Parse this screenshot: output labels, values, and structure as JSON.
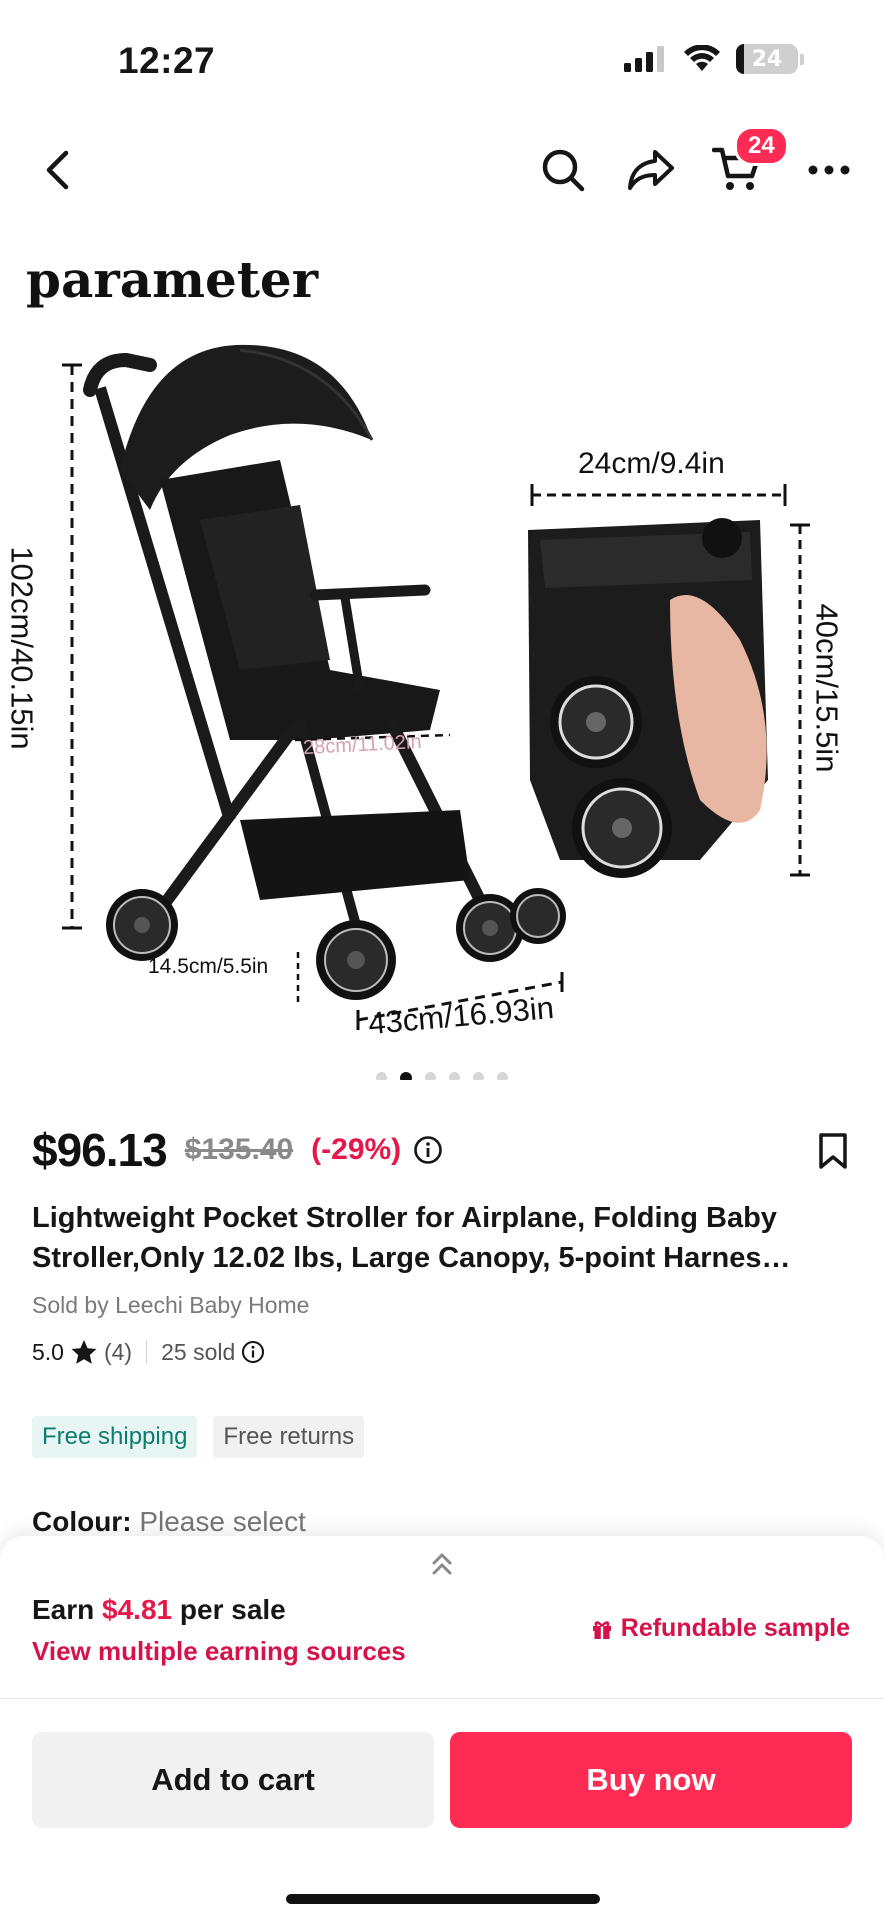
{
  "status": {
    "time": "12:27",
    "battery": "24"
  },
  "nav": {
    "cart_count": "24"
  },
  "gallery": {
    "heading": "parameter",
    "dims": {
      "height": "102cm/40.15in",
      "folded_width": "24cm/9.4in",
      "folded_height": "40cm/15.5in",
      "seat_width": "28cm/11.02in",
      "wheel": "14.5cm/5.5in",
      "length": "43cm/16.93in"
    },
    "dots_total": 6,
    "dots_active": 2
  },
  "product": {
    "price": "$96.13",
    "original_price": "$135.40",
    "discount": "(-29%)",
    "title": "Lightweight Pocket Stroller for Airplane, Folding Baby Stroller,Only 12.02 lbs, Large Canopy, 5-point Harnes…",
    "seller": "Sold by Leechi Baby Home",
    "rating": "5.0",
    "review_count": "(4)",
    "sold": "25 sold",
    "tags": {
      "shipping": "Free shipping",
      "returns": "Free returns"
    },
    "colour_label": "Colour:",
    "colour_value": "Please select"
  },
  "sheet": {
    "earn_prefix": "Earn",
    "earn_amount": "$4.81",
    "earn_suffix": "per sale",
    "earn_link": "View multiple earning sources",
    "refundable": "Refundable sample",
    "add_to_cart": "Add to cart",
    "buy_now": "Buy now"
  },
  "colors": {
    "accent": "#fe2c55",
    "accent_text": "#e6174a",
    "shipping_green": "#0d7c70"
  }
}
